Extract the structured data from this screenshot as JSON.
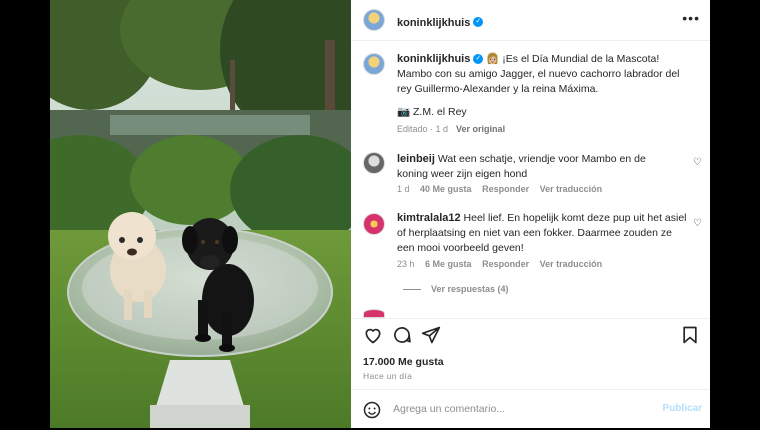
{
  "post": {
    "author": "koninklijkhuis",
    "caption": "👩🏼 ¡Es el Día Mundial de la Mascota! Mambo con su amigo Jagger, el nuevo cachorro labrador del rey Guillermo-Alexander y la reina Máxima.",
    "credit": "📷 Z.M. el Rey",
    "edited": "Editado · 1 d",
    "see_original": "Ver original"
  },
  "comments": [
    {
      "user": "leinbeij",
      "text": "Wat een schatje, vriendje voor Mambo en de koning weer zijn eigen hond",
      "time": "1 d",
      "likes": "40 Me gusta",
      "reply": "Responder",
      "translate": "Ver traducción"
    },
    {
      "user": "kimtralala12",
      "text": "Heel lief. En hopelijk komt deze pup uit het asiel of herplaatsing en niet van een fokker. Daarmee zouden ze een mooi voorbeeld geven!",
      "time": "23 h",
      "likes": "6 Me gusta",
      "reply": "Responder",
      "translate": "Ver traducción",
      "view_replies": "Ver respuestas (4)"
    }
  ],
  "footer": {
    "likes": "17.000 Me gusta",
    "time": "Hace un día",
    "comment_placeholder": "Agrega un comentario...",
    "publish": "Publicar"
  },
  "colors": {
    "link_blue": "#0095f6",
    "muted": "#8e8e8e",
    "publish_disabled": "#b2dffc"
  },
  "icons": [
    "more-icon",
    "verified-icon",
    "heart-icon",
    "comment-icon",
    "share-icon",
    "bookmark-icon",
    "emoji-icon"
  ]
}
